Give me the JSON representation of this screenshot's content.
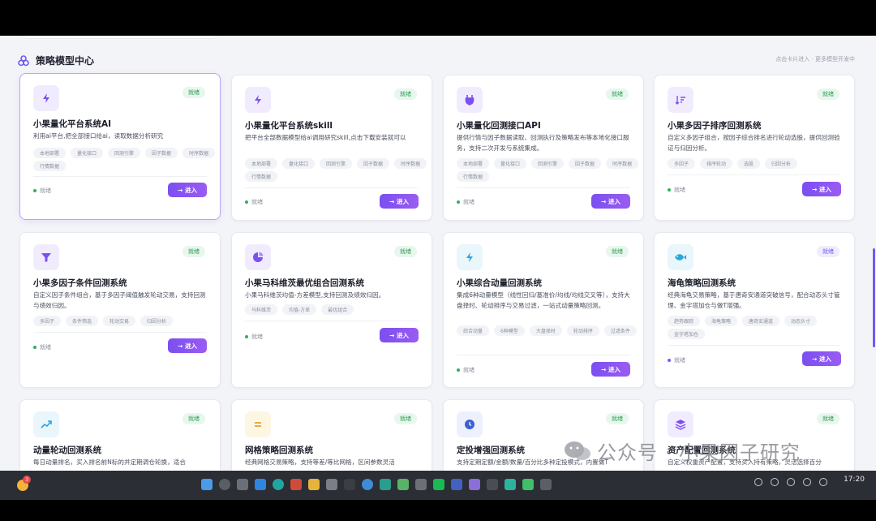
{
  "section": {
    "title": "策略模型中心",
    "hint": "点击卡片进入 · 更多模型开发中"
  },
  "cards": [
    {
      "title": "小果量化平台系统AI",
      "desc": "利用ai平台,把全部接口给ai，读取数据分析研究",
      "badge": "就绪",
      "status": "就绪",
      "button": "→ 进入",
      "icon": "lightning-icon",
      "tags": [
        "本地部署",
        "量化接口",
        "回测引擎",
        "因子数据",
        "时序数据",
        "行情数据"
      ]
    },
    {
      "title": "小果量化平台系统skill",
      "desc": "把平台全部数据模型给ai调用研究skill,点击下载安装就可以",
      "badge": "就绪",
      "status": "就绪",
      "button": "→ 进入",
      "icon": "lightning-icon",
      "tags": [
        "本地部署",
        "量化接口",
        "回测引擎",
        "因子数据",
        "时序数据",
        "行情数据"
      ]
    },
    {
      "title": "小果量化回测接口API",
      "desc": "提供行情与因子数据读取、回测执行及策略发布等本地化接口服务，支持二次开发与系统集成。",
      "badge": "就绪",
      "status": "就绪",
      "button": "→ 进入",
      "icon": "plug-icon",
      "tags": [
        "本地部署",
        "量化接口",
        "回测引擎",
        "因子数据",
        "时序数据",
        "行情数据"
      ]
    },
    {
      "title": "小果多因子排序回测系统",
      "desc": "自定义多因子组合，按因子综合排名进行轮动选股，提供回测验证与归因分析。",
      "badge": "就绪",
      "status": "就绪",
      "button": "→ 进入",
      "icon": "sort-icon",
      "tags": [
        "多因子",
        "排序轮动",
        "选股",
        "归因分析"
      ]
    },
    {
      "title": "小果多因子条件回测系统",
      "desc": "自定义因子条件组合，基于多因子阈值触发轮动交易，支持回测与绩效归因。",
      "badge": "就绪",
      "status": "就绪",
      "button": "→ 进入",
      "icon": "filter-icon",
      "tags": [
        "多因子",
        "条件筛选",
        "轮动交易",
        "归因分析"
      ]
    },
    {
      "title": "小果马科维茨最优组合回测系统",
      "desc": "小果马科维茨均值-方差模型,支持回测及绩效归因。",
      "badge": "就绪",
      "status": "就绪",
      "button": "→ 进入",
      "icon": "pie-chart-icon",
      "tags": [
        "马科维茨",
        "均值-方差",
        "最优组合"
      ]
    },
    {
      "title": "小果综合动量回测系统",
      "desc": "集成6种动量模型（线性回归/基准价/均线/均线交叉等），支持大盘择时、轮动排序与交易过滤，一站式动量策略回测。",
      "badge": "就绪",
      "status": "就绪",
      "button": "→ 进入",
      "icon": "lightning-icon",
      "tags": [
        "综合动量",
        "6种模型",
        "大盘择时",
        "轮动排序",
        "过滤条件"
      ]
    },
    {
      "title": "海龟策略回测系统",
      "desc": "经典海龟交易策略，基于唐奇安通道突破信号，配合动态头寸管理、金字塔加仓与做T增强。",
      "badge": "就绪",
      "status": "就绪",
      "button": "→ 进入",
      "icon": "fish-icon",
      "tags": [
        "趋势跟踪",
        "海龟策略",
        "唐奇安通道",
        "动态头寸",
        "金字塔加仓"
      ]
    },
    {
      "title": "动量轮动回测系统",
      "desc": "每日动量排名，买入排名前N标的并定期调仓轮换，适合",
      "badge": "就绪",
      "icon": "trend-up-icon"
    },
    {
      "title": "网格策略回测系统",
      "desc": "经典网格交易策略，支持等差/等比网格，区间参数灵活",
      "badge": "就绪",
      "icon": "equals-icon"
    },
    {
      "title": "定投增强回测系统",
      "desc": "支持定期定额/金额/数量/百分比多种定投模式，内置做T",
      "badge": "就绪",
      "icon": "clock-icon"
    },
    {
      "title": "资产配置回测系统",
      "desc": "自定义权重资产配置，支持买入持有策略，灵活选择百分",
      "badge": "就绪",
      "icon": "layers-icon"
    }
  ],
  "watermark": "公众号 · 小果因子研究",
  "taskbar": {
    "notification_count": "3",
    "time": "17:20"
  }
}
